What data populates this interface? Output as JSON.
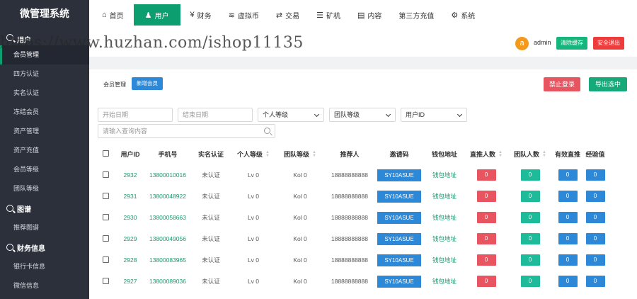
{
  "brand": "微管理系统",
  "watermark": "https://www.huzhan.com/ishop11135",
  "sidebar": {
    "sections": [
      {
        "label": "用户",
        "items": [
          "会员管理",
          "四方认证",
          "实名认证",
          "冻结会员",
          "资产管理",
          "资产充值",
          "会员等级",
          "团队等级"
        ]
      },
      {
        "label": "图谱",
        "items": [
          "推荐图谱"
        ]
      },
      {
        "label": "财务信息",
        "items": [
          "银行卡信息",
          "微信信息"
        ]
      }
    ],
    "active_item": "会员管理"
  },
  "topnav": [
    {
      "label": "首页",
      "icon": "home-icon",
      "glyph": "⌂"
    },
    {
      "label": "用户",
      "icon": "user-icon",
      "glyph": "♟",
      "active": true
    },
    {
      "label": "财务",
      "icon": "finance-icon",
      "glyph": "¥"
    },
    {
      "label": "虚拟币",
      "icon": "coins-icon",
      "glyph": "≋"
    },
    {
      "label": "交易",
      "icon": "exchange-icon",
      "glyph": "⇄"
    },
    {
      "label": "矿机",
      "icon": "server-icon",
      "glyph": "☰"
    },
    {
      "label": "内容",
      "icon": "content-icon",
      "glyph": "▤"
    },
    {
      "label": "第三方充值",
      "icon": "",
      "glyph": ""
    },
    {
      "label": "系统",
      "icon": "gear-icon",
      "glyph": "⚙"
    }
  ],
  "user": {
    "avatar_letter": "a",
    "name": "admin",
    "clear_cache": "清除缓存",
    "logout": "安全退出"
  },
  "panel": {
    "crumb": "会员管理",
    "add_member": "新增会员",
    "ban_login": "禁止登录",
    "export_selected": "导出选中"
  },
  "filters": {
    "start_date": "开始日期",
    "end_date": "结束日期",
    "personal_level": "个人等级",
    "team_level": "团队等级",
    "user_id": "用户ID",
    "search": "请输入查询内容"
  },
  "table": {
    "headers": [
      "用户ID",
      "手机号",
      "实名认证",
      "个人等级",
      "团队等级",
      "推荐人",
      "邀请码",
      "钱包地址",
      "直推人数",
      "团队人数",
      "有效直推",
      "经验值"
    ],
    "rows": [
      {
        "id": "2932",
        "phone": "13800010016",
        "realname": "未认证",
        "level": "Lv 0",
        "team": "Kol 0",
        "referrer": "18888888888",
        "invite": "SY10ASUE",
        "wallet": "钱包地址",
        "direct": "0",
        "team_count": "0",
        "valid": "0",
        "exp": "0"
      },
      {
        "id": "2931",
        "phone": "13800048922",
        "realname": "未认证",
        "level": "Lv 0",
        "team": "Kol 0",
        "referrer": "18888888888",
        "invite": "SY10ASUE",
        "wallet": "钱包地址",
        "direct": "0",
        "team_count": "0",
        "valid": "0",
        "exp": "0"
      },
      {
        "id": "2930",
        "phone": "13800058663",
        "realname": "未认证",
        "level": "Lv 0",
        "team": "Kol 0",
        "referrer": "18888888888",
        "invite": "SY10ASUE",
        "wallet": "钱包地址",
        "direct": "0",
        "team_count": "0",
        "valid": "0",
        "exp": "0"
      },
      {
        "id": "2929",
        "phone": "13800049056",
        "realname": "未认证",
        "level": "Lv 0",
        "team": "Kol 0",
        "referrer": "18888888888",
        "invite": "SY10ASUE",
        "wallet": "钱包地址",
        "direct": "0",
        "team_count": "0",
        "valid": "0",
        "exp": "0"
      },
      {
        "id": "2928",
        "phone": "13800083965",
        "realname": "未认证",
        "level": "Lv 0",
        "team": "Kol 0",
        "referrer": "18888888888",
        "invite": "SY10ASUE",
        "wallet": "钱包地址",
        "direct": "0",
        "team_count": "0",
        "valid": "0",
        "exp": "0"
      },
      {
        "id": "2927",
        "phone": "13800089036",
        "realname": "未认证",
        "level": "Lv 0",
        "team": "Kol 0",
        "referrer": "18888888888",
        "invite": "SY10ASUE",
        "wallet": "钱包地址",
        "direct": "0",
        "team_count": "0",
        "valid": "0",
        "exp": "0"
      },
      {
        "id": "",
        "phone": "",
        "realname": "",
        "level": "",
        "team": "",
        "referrer": "",
        "invite": "",
        "wallet": "",
        "direct": "",
        "team_count": "",
        "valid": "",
        "exp": ""
      }
    ]
  },
  "colors": {
    "accent": "#0c9e6f",
    "sidebar": "#2b303b",
    "red": "#e85560",
    "teal": "#1dbb9a",
    "blue": "#2d89d8"
  }
}
